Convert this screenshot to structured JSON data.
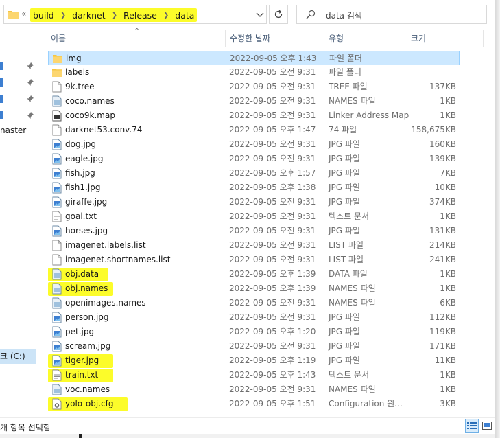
{
  "breadcrumb": {
    "overflow": "«",
    "items": [
      "build",
      "darknet",
      "Release",
      "data"
    ]
  },
  "search": {
    "placeholder": "data 검색"
  },
  "nav": {
    "master_label": "naster",
    "drive_label": "크 (C:)"
  },
  "columns": {
    "name": "이름",
    "date": "수정한 날짜",
    "type": "유형",
    "size": "크기"
  },
  "files": [
    {
      "name": "img",
      "date": "2022-09-05 오후 1:43",
      "type": "파일 폴더",
      "size": "",
      "icon": "folder-icon",
      "selected": true
    },
    {
      "name": "labels",
      "date": "2022-09-05 오전 9:31",
      "type": "파일 폴더",
      "size": "",
      "icon": "folder-icon"
    },
    {
      "name": "9k.tree",
      "date": "2022-09-05 오전 9:31",
      "type": "TREE 파일",
      "size": "137KB",
      "icon": "file-icon"
    },
    {
      "name": "coco.names",
      "date": "2022-09-05 오전 9:31",
      "type": "NAMES 파일",
      "size": "1KB",
      "icon": "names-file-icon"
    },
    {
      "name": "coco9k.map",
      "date": "2022-09-05 오전 9:31",
      "type": "Linker Address Map",
      "size": "1KB",
      "icon": "map-file-icon"
    },
    {
      "name": "darknet53.conv.74",
      "date": "2022-09-05 오후 1:47",
      "type": "74 파일",
      "size": "158,675KB",
      "icon": "file-icon"
    },
    {
      "name": "dog.jpg",
      "date": "2022-09-05 오전 9:31",
      "type": "JPG 파일",
      "size": "160KB",
      "icon": "image-file-icon"
    },
    {
      "name": "eagle.jpg",
      "date": "2022-09-05 오전 9:31",
      "type": "JPG 파일",
      "size": "139KB",
      "icon": "image-file-icon"
    },
    {
      "name": "fish.jpg",
      "date": "2022-09-05 오후 1:57",
      "type": "JPG 파일",
      "size": "7KB",
      "icon": "image-file-icon"
    },
    {
      "name": "fish1.jpg",
      "date": "2022-09-05 오후 1:38",
      "type": "JPG 파일",
      "size": "10KB",
      "icon": "image-file-icon"
    },
    {
      "name": "giraffe.jpg",
      "date": "2022-09-05 오전 9:31",
      "type": "JPG 파일",
      "size": "374KB",
      "icon": "image-file-icon"
    },
    {
      "name": "goal.txt",
      "date": "2022-09-05 오전 9:31",
      "type": "텍스트 문서",
      "size": "1KB",
      "icon": "text-file-icon"
    },
    {
      "name": "horses.jpg",
      "date": "2022-09-05 오전 9:31",
      "type": "JPG 파일",
      "size": "131KB",
      "icon": "image-file-icon"
    },
    {
      "name": "imagenet.labels.list",
      "date": "2022-09-05 오전 9:31",
      "type": "LIST 파일",
      "size": "214KB",
      "icon": "file-icon"
    },
    {
      "name": "imagenet.shortnames.list",
      "date": "2022-09-05 오전 9:31",
      "type": "LIST 파일",
      "size": "241KB",
      "icon": "file-icon"
    },
    {
      "name": "obj.data",
      "date": "2022-09-05 오후 1:39",
      "type": "DATA 파일",
      "size": "1KB",
      "icon": "data-file-icon",
      "highlight": true
    },
    {
      "name": "obj.names",
      "date": "2022-09-05 오후 1:39",
      "type": "NAMES 파일",
      "size": "1KB",
      "icon": "names-file-icon",
      "highlight": true
    },
    {
      "name": "openimages.names",
      "date": "2022-09-05 오전 9:31",
      "type": "NAMES 파일",
      "size": "6KB",
      "icon": "names-file-icon"
    },
    {
      "name": "person.jpg",
      "date": "2022-09-05 오전 9:31",
      "type": "JPG 파일",
      "size": "112KB",
      "icon": "image-file-icon"
    },
    {
      "name": "pet.jpg",
      "date": "2022-09-05 오후 1:20",
      "type": "JPG 파일",
      "size": "119KB",
      "icon": "image-file-icon"
    },
    {
      "name": "scream.jpg",
      "date": "2022-09-05 오전 9:31",
      "type": "JPG 파일",
      "size": "171KB",
      "icon": "image-file-icon"
    },
    {
      "name": "tiger.jpg",
      "date": "2022-09-05 오후 1:19",
      "type": "JPG 파일",
      "size": "11KB",
      "icon": "image-file-icon",
      "highlight": true
    },
    {
      "name": "train.txt",
      "date": "2022-09-05 오후 1:43",
      "type": "텍스트 문서",
      "size": "1KB",
      "icon": "text-file-icon",
      "highlight": true
    },
    {
      "name": "voc.names",
      "date": "2022-09-05 오전 9:31",
      "type": "NAMES 파일",
      "size": "1KB",
      "icon": "names-file-icon"
    },
    {
      "name": "yolo-obj.cfg",
      "date": "2022-09-05 오후 1:51",
      "type": "Configuration 원...",
      "size": "3KB",
      "icon": "config-file-icon",
      "highlight": true
    }
  ],
  "status": {
    "text": "개 항목 선택함"
  },
  "colors": {
    "highlight": "#fcfc2a",
    "selection": "#cce8ff",
    "folder": "#f5c542"
  }
}
